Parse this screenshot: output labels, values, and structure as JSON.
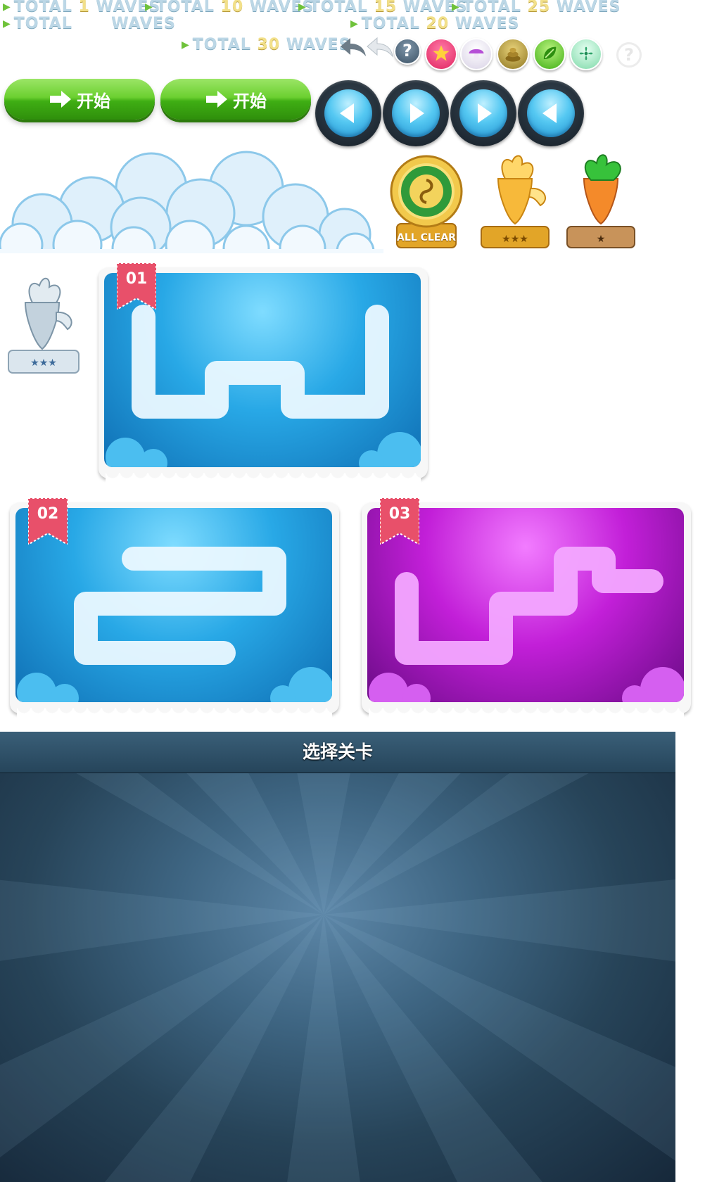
{
  "waves": [
    {
      "prefix": "TOTAL",
      "num": "1",
      "suffix": "WAVES"
    },
    {
      "prefix": "TOTAL",
      "num": "10",
      "suffix": "WAVES"
    },
    {
      "prefix": "TOTAL",
      "num": "15",
      "suffix": "WAVES"
    },
    {
      "prefix": "TOTAL",
      "num": "25",
      "suffix": "WAVES"
    },
    {
      "prefix": "TOTAL",
      "num": "",
      "suffix": "WAVES"
    },
    {
      "prefix": "TOTAL",
      "num": "20",
      "suffix": "WAVES"
    },
    {
      "prefix": "TOTAL",
      "num": "30",
      "suffix": "WAVES"
    }
  ],
  "start_buttons": [
    {
      "label": "开始"
    },
    {
      "label": "开始"
    }
  ],
  "nav_buttons": [
    "left-arrow",
    "right-arrow",
    "right-arrow",
    "left-arrow"
  ],
  "help_icon": "?",
  "trophies": [
    {
      "label": "ALL CLEAR"
    },
    {
      "label": "★★★"
    },
    {
      "label": "★"
    }
  ],
  "silver_trophy_label": "★★★",
  "levels": [
    {
      "number": "01",
      "theme": "blue"
    },
    {
      "number": "02",
      "theme": "blue"
    },
    {
      "number": "03",
      "theme": "purple"
    }
  ],
  "panel": {
    "title": "选择关卡"
  },
  "colors": {
    "green_button": "#5cc625",
    "blue_level": "#1b9ad8",
    "purple_level": "#a316c4",
    "ribbon": "#e8506a",
    "panel_bg": "#2e4e66"
  }
}
